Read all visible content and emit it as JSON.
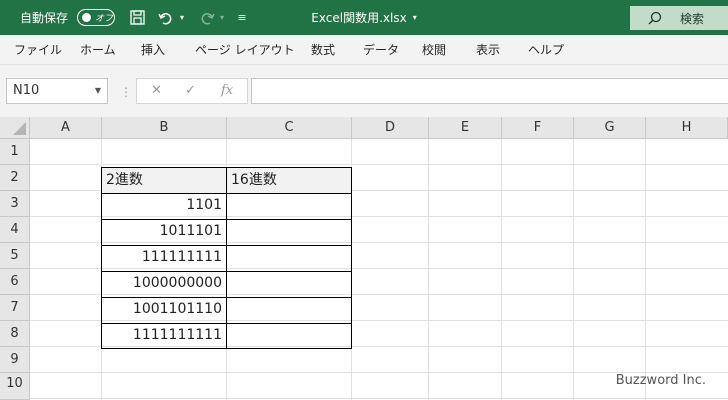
{
  "titlebar": {
    "autosave_label": "自動保存",
    "autosave_state": "オフ",
    "file_title": "Excel関数用.xlsx",
    "search_label": "検索"
  },
  "ribbon": {
    "tabs": [
      "ファイル",
      "ホーム",
      "挿入",
      "ページ レイアウト",
      "数式",
      "データ",
      "校閲",
      "表示",
      "ヘルプ"
    ]
  },
  "formula_bar": {
    "name_box": "N10",
    "fx_label": "fx",
    "formula": ""
  },
  "grid": {
    "columns": [
      "A",
      "B",
      "C",
      "D",
      "E",
      "F",
      "G",
      "H"
    ],
    "rows": [
      "1",
      "2",
      "3",
      "4",
      "5",
      "6",
      "7",
      "8",
      "9",
      "10"
    ],
    "header_b": "2進数",
    "header_c": "16進数",
    "values_b": [
      "1101",
      "1011101",
      "111111111",
      "1000000000",
      "1001101110",
      "1111111111"
    ]
  },
  "watermark": "Buzzword Inc.",
  "colors": {
    "excel_green": "#217346",
    "ribbon_bg": "#f3f3f3",
    "header_bg": "#e6e6e6"
  }
}
